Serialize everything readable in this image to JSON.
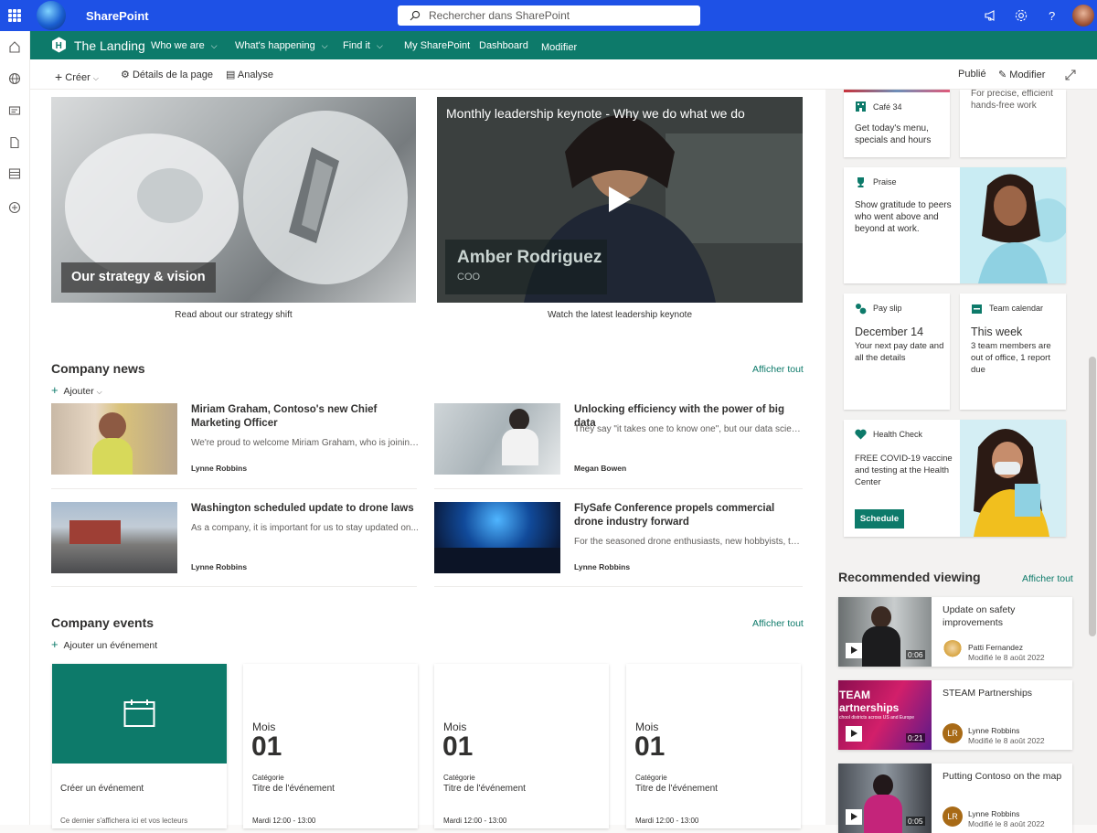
{
  "suite": {
    "app_name": "SharePoint",
    "search_placeholder": "Rechercher dans SharePoint"
  },
  "hub": {
    "title": "The Landing",
    "links": [
      "Who we are",
      "What's happening",
      "Find it",
      "My SharePoint",
      "Dashboard",
      "Modifier"
    ]
  },
  "command": {
    "create": "Créer",
    "page_details": "Détails de la page",
    "analytics": "Analyse",
    "status": "Publié",
    "edit": "Modifier"
  },
  "heroes": [
    {
      "overlay": "Our strategy & vision",
      "caption": "Read about our strategy shift"
    },
    {
      "title": "Monthly leadership keynote - Why we do what we do",
      "name": "Amber Rodriguez",
      "role": "COO",
      "caption": "Watch the latest leadership keynote"
    }
  ],
  "news": {
    "title": "Company news",
    "see_all": "Afficher tout",
    "add": "Ajouter",
    "items": [
      {
        "title": "Miriam Graham, Contoso's new Chief Marketing Officer",
        "desc": "We're proud to welcome Miriam Graham, who is joining...",
        "author": "Lynne Robbins"
      },
      {
        "title": "Unlocking efficiency with the power of big data",
        "desc": "They say \"it takes one to know one\", but our data scien...",
        "author": "Megan Bowen"
      },
      {
        "title": "Washington scheduled update to drone laws",
        "desc": "As a company, it is important for us to stay updated on...",
        "author": "Lynne Robbins"
      },
      {
        "title": "FlySafe Conference propels commercial drone industry forward",
        "desc": "For the seasoned drone enthusiasts, new hobbyists, to...",
        "author": "Lynne Robbins"
      }
    ]
  },
  "events": {
    "title": "Company events",
    "see_all": "Afficher tout",
    "add": "Ajouter un événement",
    "create_title": "Créer un événement",
    "create_desc": "Ce dernier s'affichera ici et vos lecteurs",
    "items": [
      {
        "month": "Mois",
        "day": "01",
        "category": "Catégorie",
        "name": "Titre de l'événement",
        "time": "Mardi 12:00 - 13:00"
      },
      {
        "month": "Mois",
        "day": "01",
        "category": "Catégorie",
        "name": "Titre de l'événement",
        "time": "Mardi 12:00 - 13:00"
      },
      {
        "month": "Mois",
        "day": "01",
        "category": "Catégorie",
        "name": "Titre de l'événement",
        "time": "Mardi 12:00 - 13:00"
      }
    ]
  },
  "cards": {
    "cafe": {
      "title": "Café 34",
      "body": "Get today's menu, specials and hours"
    },
    "handsfree": {
      "body": "For precise, efficient hands-free work"
    },
    "praise": {
      "title": "Praise",
      "body": "Show gratitude to peers who went above and beyond at work."
    },
    "payslip": {
      "title": "Pay slip",
      "head": "December 14",
      "body": "Your next pay date and all the details"
    },
    "calendar": {
      "title": "Team calendar",
      "head": "This week",
      "body": "3 team members are out of office, 1 report due"
    },
    "health": {
      "title": "Health Check",
      "body": "FREE COVID-19 vaccine and testing at the Health Center",
      "button": "Schedule"
    }
  },
  "recommended": {
    "title": "Recommended viewing",
    "see_all": "Afficher tout",
    "items": [
      {
        "title": "Update on safety improvements",
        "author": "Patti Fernandez",
        "modified": "Modifié le 8 août 2022",
        "duration": "0:06",
        "initials": ""
      },
      {
        "title": "STEAM Partnerships",
        "author": "Lynne Robbins",
        "modified": "Modifié le 8 août 2022",
        "duration": "0:21",
        "initials": "LR",
        "thumb_text": "TEAM artnerships",
        "thumb_sub": "chool districts across US and Europe"
      },
      {
        "title": "Putting Contoso on the map",
        "author": "Lynne Robbins",
        "modified": "Modifié le 8 août 2022",
        "duration": "0:05",
        "initials": "LR"
      }
    ]
  },
  "colors": {
    "suite": "#1e51e6",
    "hub": "#0d7a6a",
    "accent": "#0d7a6a"
  }
}
